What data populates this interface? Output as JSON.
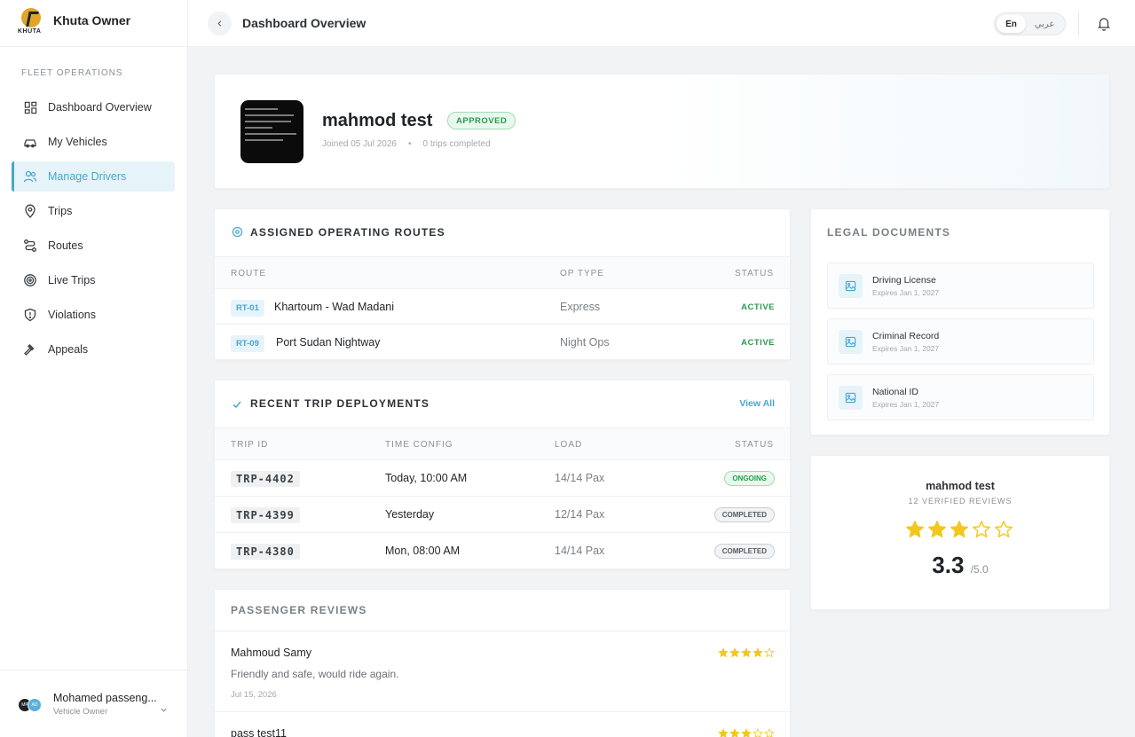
{
  "brand": {
    "name": "Khuta Owner",
    "logo_word": "KHUTA"
  },
  "sidebar": {
    "section": "FLEET OPERATIONS",
    "items": [
      {
        "label": "Dashboard Overview",
        "icon": "grid-icon"
      },
      {
        "label": "My Vehicles",
        "icon": "car-icon"
      },
      {
        "label": "Manage Drivers",
        "icon": "users-icon",
        "active": true
      },
      {
        "label": "Trips",
        "icon": "map-pin-icon"
      },
      {
        "label": "Routes",
        "icon": "route-icon"
      },
      {
        "label": "Live Trips",
        "icon": "target-icon"
      },
      {
        "label": "Violations",
        "icon": "shield-alert-icon"
      },
      {
        "label": "Appeals",
        "icon": "gavel-icon"
      }
    ],
    "user": {
      "name": "Mohamed passeng...",
      "role": "Vehicle Owner"
    }
  },
  "header": {
    "title": "Dashboard Overview",
    "lang_active": "En",
    "lang_other": "عربي"
  },
  "profile": {
    "name": "mahmod test",
    "status": "APPROVED",
    "joined": "Joined 05 Jul 2026",
    "trips": "0 trips completed"
  },
  "routes": {
    "title": "ASSIGNED OPERATING ROUTES",
    "columns": [
      "ROUTE",
      "OP TYPE",
      "STATUS"
    ],
    "rows": [
      {
        "code": "RT-01",
        "name": "Khartoum - Wad Madani",
        "type": "Express",
        "status": "ACTIVE"
      },
      {
        "code": "RT-09",
        "name": "Port Sudan Nightway",
        "type": "Night Ops",
        "status": "ACTIVE"
      }
    ]
  },
  "trips": {
    "title": "RECENT TRIP DEPLOYMENTS",
    "view_all": "View All",
    "columns": [
      "TRIP ID",
      "TIME CONFIG",
      "LOAD",
      "STATUS"
    ],
    "rows": [
      {
        "id": "TRP-4402",
        "time": "Today, 10:00 AM",
        "load": "14/14 Pax",
        "status": "ONGOING"
      },
      {
        "id": "TRP-4399",
        "time": "Yesterday",
        "load": "12/14 Pax",
        "status": "COMPLETED"
      },
      {
        "id": "TRP-4380",
        "time": "Mon, 08:00 AM",
        "load": "14/14 Pax",
        "status": "COMPLETED"
      }
    ]
  },
  "reviews": {
    "title": "PASSENGER REVIEWS",
    "items": [
      {
        "name": "Mahmoud Samy",
        "text": "Friendly and safe, would ride again.",
        "date": "Jul 15, 2026",
        "stars": 4
      },
      {
        "name": "pass test11",
        "stars": 3
      }
    ]
  },
  "legal": {
    "title": "LEGAL DOCUMENTS",
    "docs": [
      {
        "name": "Driving License",
        "expires": "Expires Jan 1, 2027"
      },
      {
        "name": "Criminal Record",
        "expires": "Expires Jan 1, 2027"
      },
      {
        "name": "National ID",
        "expires": "Expires Jan 1, 2027"
      }
    ]
  },
  "rating": {
    "name": "mahmod test",
    "reviews": "12 VERIFIED REVIEWS",
    "score": "3.3",
    "out_of": "/5.0",
    "stars": 3
  },
  "colors": {
    "accent": "#4aa5cf",
    "success": "#2b9a4f",
    "star": "#f2c81e",
    "brand_gold": "#e0a52a"
  }
}
